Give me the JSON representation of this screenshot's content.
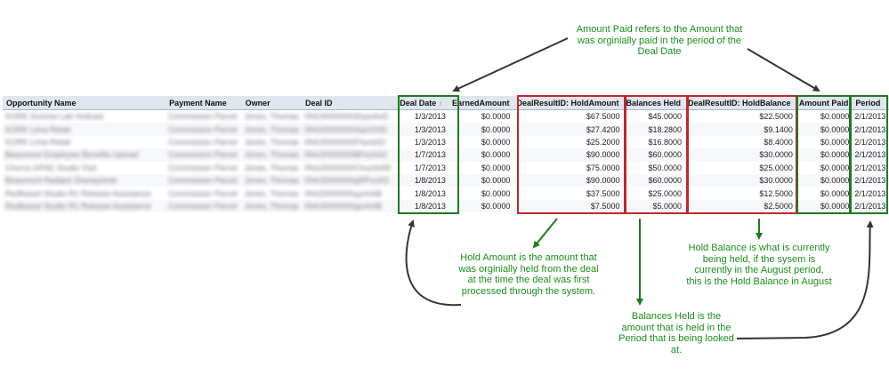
{
  "columns": [
    "Opportunity Name",
    "Payment Name",
    "Owner",
    "Deal ID",
    "Deal Date",
    "EarnedAmount",
    "DealResultID: HoldAmount",
    "Balances Held",
    "DealResultID: HoldBalance",
    "Amount Paid",
    "Period"
  ],
  "sort_indicator": "↑",
  "rows": [
    {
      "opp": "KORK Sunrise Lab Vodcast",
      "pay": "Commission Parcel",
      "owner": "Jones, Thomas",
      "deal": "0N4J0000000AhpoAoD",
      "date": "1/3/2013",
      "earned": "$0.0000",
      "hold": "$67.5000",
      "held": "$45.0000",
      "balance": "$22.5000",
      "paid": "$0.0000",
      "period": "2/1/2013"
    },
    {
      "opp": "KORK Lima Retail",
      "pay": "Commission Parcel",
      "owner": "Jones, Thomas",
      "deal": "0N4J0000000AqmG0D",
      "date": "1/3/2013",
      "earned": "$0.0000",
      "hold": "$27.4200",
      "held": "$18.2800",
      "balance": "$9.1400",
      "paid": "$0.0000",
      "period": "2/1/2013"
    },
    {
      "opp": "KORK Lima Retail",
      "pay": "Commission Parcel",
      "owner": "Jones, Thomas",
      "deal": "0N4J0000000FhyntAD",
      "date": "1/3/2013",
      "earned": "$0.0000",
      "hold": "$25.2000",
      "held": "$16.8000",
      "balance": "$8.4000",
      "paid": "$0.0000",
      "period": "2/1/2013"
    },
    {
      "opp": "Beaumont Employee Benefits Upload",
      "pay": "Commission Parcel",
      "owner": "Jones, Thomas",
      "deal": "0N4J0000000BFtuAAS",
      "date": "1/7/2013",
      "earned": "$0.0000",
      "hold": "$90.0000",
      "held": "$60.0000",
      "balance": "$30.0000",
      "paid": "$0.0000",
      "period": "2/1/2013"
    },
    {
      "opp": "Chorus DFAE Studio Visit",
      "pay": "Commission Parcel",
      "owner": "Jones, Thomas",
      "deal": "0N4J0000000ChumhAB",
      "date": "1/7/2013",
      "earned": "$0.0000",
      "hold": "$75.0000",
      "held": "$50.0000",
      "balance": "$25.0000",
      "paid": "$0.0000",
      "period": "2/1/2013"
    },
    {
      "opp": "Beaumont Radiant Sharepointe",
      "pay": "Commission Parcel",
      "owner": "Jones, Thomas",
      "deal": "0N4J0000000gRPcoAS",
      "date": "1/8/2013",
      "earned": "$0.0000",
      "hold": "$90.0000",
      "held": "$60.0000",
      "balance": "$30.0000",
      "paid": "$0.0000",
      "period": "2/1/2013"
    },
    {
      "opp": "Redfeasel Studio R1 Release Assistance",
      "pay": "Commission Parcel",
      "owner": "Jones, Thomas",
      "deal": "0N4J0000000ypvhAB",
      "date": "1/8/2013",
      "earned": "$0.0000",
      "hold": "$37.5000",
      "held": "$25.0000",
      "balance": "$12.5000",
      "paid": "$0.0000",
      "period": "2/1/2013"
    },
    {
      "opp": "Redfeasel Studio R1 Release Assistance",
      "pay": "Commission Parcel",
      "owner": "Jones, Thomas",
      "deal": "0N4J0000000ypvhAB",
      "date": "1/8/2013",
      "earned": "$0.0000",
      "hold": "$7.5000",
      "held": "$5.0000",
      "balance": "$2.5000",
      "paid": "$0.0000",
      "period": "2/1/2013"
    }
  ],
  "annotations": {
    "amount_paid": [
      "Amount Paid refers to the Amount that",
      "was orginially paid in the period of the",
      "Deal Date"
    ],
    "hold_amount": [
      "Hold Amount is the amount that",
      "was orginially held from the deal",
      "at the time the deal was first",
      "processed through the system."
    ],
    "hold_balance": [
      "Hold Balance is what is currently",
      "being held, if the sysem is",
      "currently in the August period,",
      "this is the Hold Balance in August"
    ],
    "balances_held": [
      "Balances Held is the",
      "amount that is held in the",
      "Period that is being looked",
      "at."
    ]
  },
  "colors": {
    "green": "#1f7a1f",
    "red": "#c0272d",
    "note_text": "#1a8f1a",
    "arrow": "#333333",
    "header_bg": "#dfe6ee"
  }
}
